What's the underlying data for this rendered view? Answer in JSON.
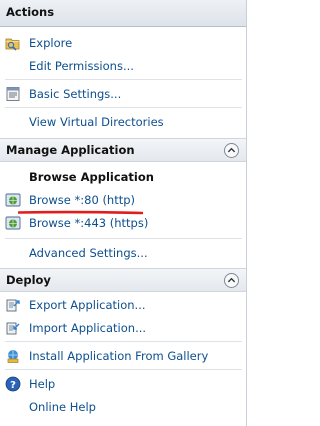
{
  "pane": {
    "title": "Actions",
    "items_top": [
      {
        "label": "Explore",
        "icon": "folder-explore-icon"
      },
      {
        "label": "Edit Permissions...",
        "icon": ""
      }
    ],
    "items_mid": [
      {
        "label": "Basic Settings...",
        "icon": "settings-page-icon"
      },
      {
        "label": "View Virtual Directories",
        "icon": ""
      }
    ]
  },
  "manage_application": {
    "title": "Manage Application",
    "subheader": "Browse Application",
    "browse_items": [
      {
        "label": "Browse *:80 (http)",
        "icon": "globe-browse-icon"
      },
      {
        "label": "Browse *:443 (https)",
        "icon": "globe-browse-icon"
      }
    ],
    "advanced_label": "Advanced Settings...",
    "highlight_color": "#e21b1b"
  },
  "deploy": {
    "title": "Deploy",
    "items": [
      {
        "label": "Export Application...",
        "icon": "export-application-icon"
      },
      {
        "label": "Import Application...",
        "icon": "import-application-icon"
      },
      {
        "label": "Install Application From Gallery",
        "icon": "gallery-install-icon"
      }
    ]
  },
  "help": {
    "help_label": "Help",
    "online_help_label": "Online Help",
    "icon": "help-icon"
  },
  "colors": {
    "link": "#0d4f8f",
    "header_bg": "#dde3ea",
    "underline": "#e21b1b"
  }
}
